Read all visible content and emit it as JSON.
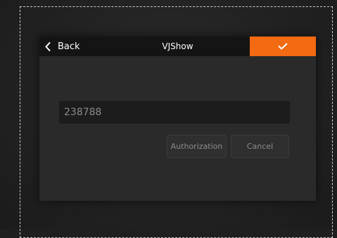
{
  "dialog": {
    "title": "VJShow",
    "back_label": "Back",
    "code_value": "238788",
    "authorization_label": "Authorization",
    "cancel_label": "Cancel"
  },
  "colors": {
    "accent": "#f26a12",
    "titlebar": "#141414",
    "dialog_bg": "#2a2a2a"
  },
  "icons": {
    "back": "chevron-left-icon",
    "confirm": "checkmark-icon"
  }
}
